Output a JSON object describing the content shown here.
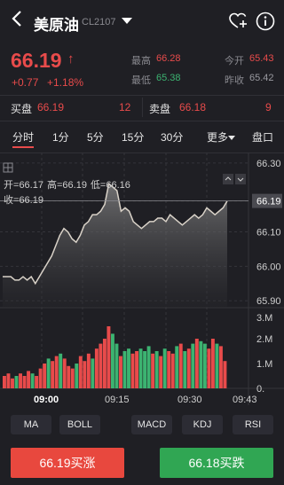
{
  "header": {
    "title": "美原油",
    "code": "CL2107"
  },
  "quote": {
    "price": "66.19",
    "arrow": "↑",
    "change": "+0.77",
    "change_pct": "+1.18%",
    "high_label": "最高",
    "high": "66.28",
    "low_label": "最低",
    "low": "65.38",
    "open_label": "今开",
    "open": "65.43",
    "prev_close_label": "昨收",
    "prev_close": "65.42"
  },
  "orderbook": {
    "bid_label": "买盘",
    "bid_price": "66.19",
    "bid_size": "12",
    "ask_label": "卖盘",
    "ask_price": "66.18",
    "ask_size": "9"
  },
  "tabs": [
    "分时",
    "1分",
    "5分",
    "15分",
    "30分",
    "更多",
    "盘口"
  ],
  "info": {
    "open_label": "开=",
    "open": "66.17",
    "high_label": "高=",
    "high": "66.19",
    "low_label": "低=",
    "low": "66.16",
    "close_label": "收=",
    "close": "66.19"
  },
  "chart_data": {
    "type": "area",
    "price_axis": [
      "66.30",
      "66.19",
      "66.10",
      "66.00",
      "65.90"
    ],
    "current_price_label": "66.19",
    "volume_axis": [
      "3.M",
      "2.M",
      "1.M",
      "0."
    ],
    "time_labels": [
      "09:00",
      "09:15",
      "09:30",
      "09:43"
    ],
    "price_ylim": [
      65.88,
      66.31
    ],
    "volume_ylim": [
      0,
      3.0
    ],
    "price": [
      65.97,
      65.97,
      65.97,
      65.96,
      65.96,
      65.97,
      65.96,
      65.97,
      65.95,
      65.97,
      65.99,
      66.01,
      66.03,
      66.06,
      66.09,
      66.11,
      66.1,
      66.08,
      66.07,
      66.09,
      66.12,
      66.13,
      66.15,
      66.15,
      66.16,
      66.18,
      66.24,
      66.23,
      66.22,
      66.16,
      66.17,
      66.16,
      66.13,
      66.12,
      66.11,
      66.12,
      66.13,
      66.13,
      66.14,
      66.14,
      66.13,
      66.15,
      66.14,
      66.13,
      66.12,
      66.13,
      66.14,
      66.15,
      66.14,
      66.15,
      66.17,
      66.16,
      66.15,
      66.16,
      66.17,
      66.19
    ],
    "volume": [
      0.5,
      0.6,
      0.4,
      0.5,
      0.6,
      0.5,
      0.7,
      0.6,
      0.5,
      0.8,
      1.0,
      1.2,
      1.1,
      1.3,
      1.4,
      1.2,
      0.9,
      0.8,
      1.0,
      1.3,
      1.1,
      1.4,
      1.2,
      1.6,
      1.8,
      2.0,
      2.5,
      2.2,
      1.8,
      1.3,
      1.5,
      1.6,
      1.4,
      1.5,
      1.6,
      1.5,
      1.7,
      1.4,
      1.5,
      1.3,
      1.6,
      1.5,
      1.4,
      1.7,
      1.8,
      1.5,
      1.6,
      1.8,
      2.0,
      1.9,
      1.8,
      1.6,
      2.0,
      1.8,
      1.7,
      1.1
    ],
    "volume_direction": [
      "r",
      "r",
      "r",
      "g",
      "r",
      "r",
      "r",
      "g",
      "r",
      "r",
      "r",
      "g",
      "r",
      "r",
      "g",
      "r",
      "r",
      "r",
      "g",
      "r",
      "r",
      "r",
      "g",
      "r",
      "r",
      "r",
      "r",
      "g",
      "g",
      "r",
      "g",
      "g",
      "r",
      "r",
      "g",
      "g",
      "g",
      "r",
      "g",
      "r",
      "g",
      "r",
      "r",
      "g",
      "r",
      "g",
      "r",
      "g",
      "r",
      "g",
      "g",
      "r",
      "r",
      "g",
      "r",
      "r"
    ]
  },
  "indicators": [
    "MA",
    "BOLL",
    "MACD",
    "KDJ",
    "RSI"
  ],
  "actions": {
    "buy": "66.19买涨",
    "sell": "66.18买跌"
  },
  "colors": {
    "up": "#e84b4b",
    "down": "#3cb371",
    "background": "#1f1f24",
    "buy_button": "#e8483e",
    "sell_button": "#30a653"
  }
}
